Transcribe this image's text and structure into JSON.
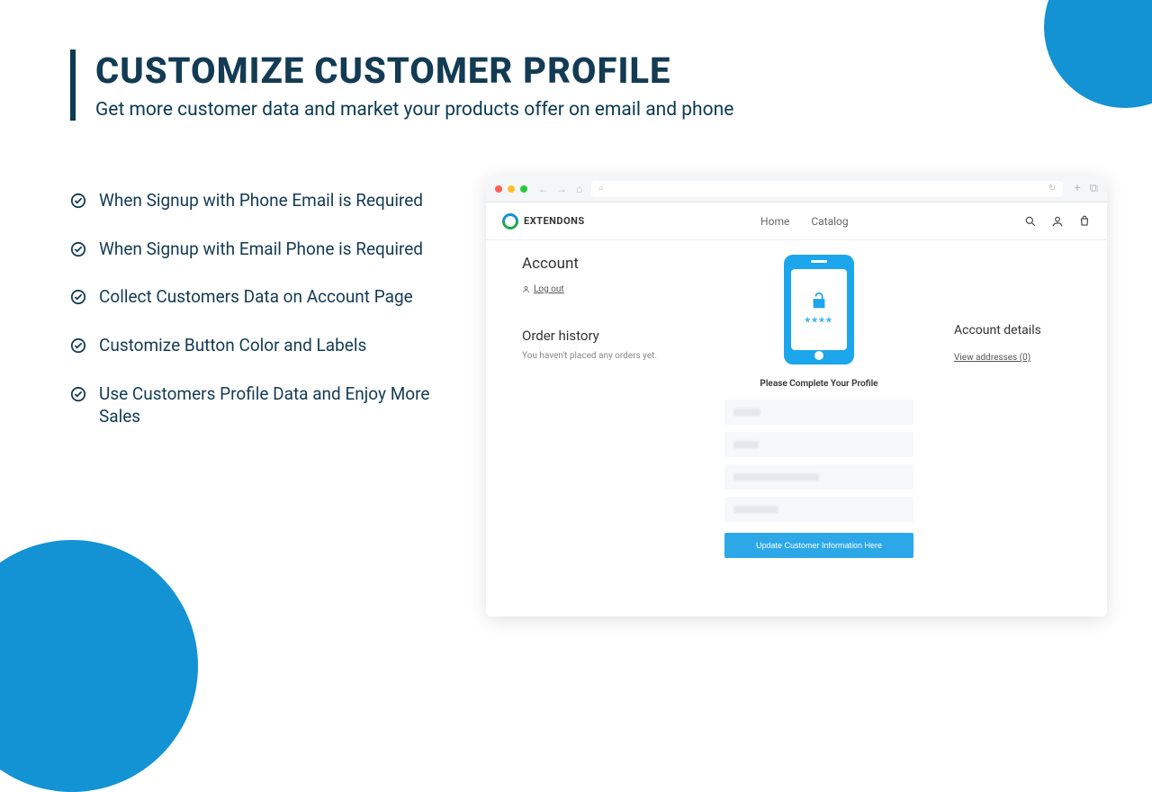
{
  "header": {
    "title": "Customize Customer Profile",
    "subtitle": "Get more customer data and market your products offer on email and phone"
  },
  "bullets": [
    "When Signup with Phone Email is Required",
    "When Signup with Email Phone is Required",
    "Collect Customers Data on Account Page",
    "Customize Button Color and Labels",
    "Use Customers Profile Data and Enjoy More Sales"
  ],
  "browser": {
    "logo": "EXTENDONS",
    "nav": {
      "home": "Home",
      "catalog": "Catalog"
    }
  },
  "account": {
    "title": "Account",
    "logout": "Log out",
    "order_history": "Order history",
    "order_empty": "You haven't placed any orders yet.",
    "details_title": "Account details",
    "view_addresses": "View addresses (0)",
    "stars": "****",
    "complete_profile": "Please Complete Your Profile",
    "submit": "Update Customer Information Here"
  }
}
